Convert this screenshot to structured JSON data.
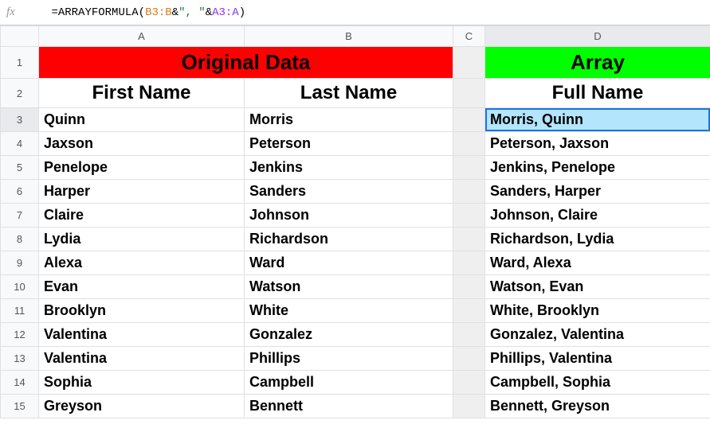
{
  "fx_label": "fx",
  "formula": {
    "prefix": "=ARRAYFORMULA(",
    "ref1": "B3:B",
    "amp1": "&",
    "literal": "\", \"",
    "amp2": "&",
    "ref2": "A3:A",
    "suffix": ")"
  },
  "col_headers": [
    "A",
    "B",
    "C",
    "D"
  ],
  "row_headers": [
    "1",
    "2",
    "3",
    "4",
    "5",
    "6",
    "7",
    "8",
    "9",
    "10",
    "11",
    "12",
    "13",
    "14",
    "15"
  ],
  "titles": {
    "original_data": "Original Data",
    "array": "Array"
  },
  "subtitles": {
    "first_name": "First Name",
    "last_name": "Last Name",
    "full_name": "Full Name"
  },
  "rows": [
    {
      "first": "Quinn",
      "last": "Morris",
      "full": "Morris, Quinn"
    },
    {
      "first": "Jaxson",
      "last": "Peterson",
      "full": "Peterson, Jaxson"
    },
    {
      "first": "Penelope",
      "last": "Jenkins",
      "full": "Jenkins, Penelope"
    },
    {
      "first": "Harper",
      "last": "Sanders",
      "full": "Sanders, Harper"
    },
    {
      "first": "Claire",
      "last": "Johnson",
      "full": "Johnson, Claire"
    },
    {
      "first": "Lydia",
      "last": "Richardson",
      "full": "Richardson, Lydia"
    },
    {
      "first": "Alexa",
      "last": "Ward",
      "full": "Ward, Alexa"
    },
    {
      "first": "Evan",
      "last": "Watson",
      "full": "Watson, Evan"
    },
    {
      "first": "Brooklyn",
      "last": "White",
      "full": "White, Brooklyn"
    },
    {
      "first": "Valentina",
      "last": "Gonzalez",
      "full": "Gonzalez, Valentina"
    },
    {
      "first": "Valentina",
      "last": "Phillips",
      "full": "Phillips, Valentina"
    },
    {
      "first": "Sophia",
      "last": "Campbell",
      "full": "Campbell, Sophia"
    },
    {
      "first": "Greyson",
      "last": "Bennett",
      "full": "Bennett, Greyson"
    }
  ]
}
